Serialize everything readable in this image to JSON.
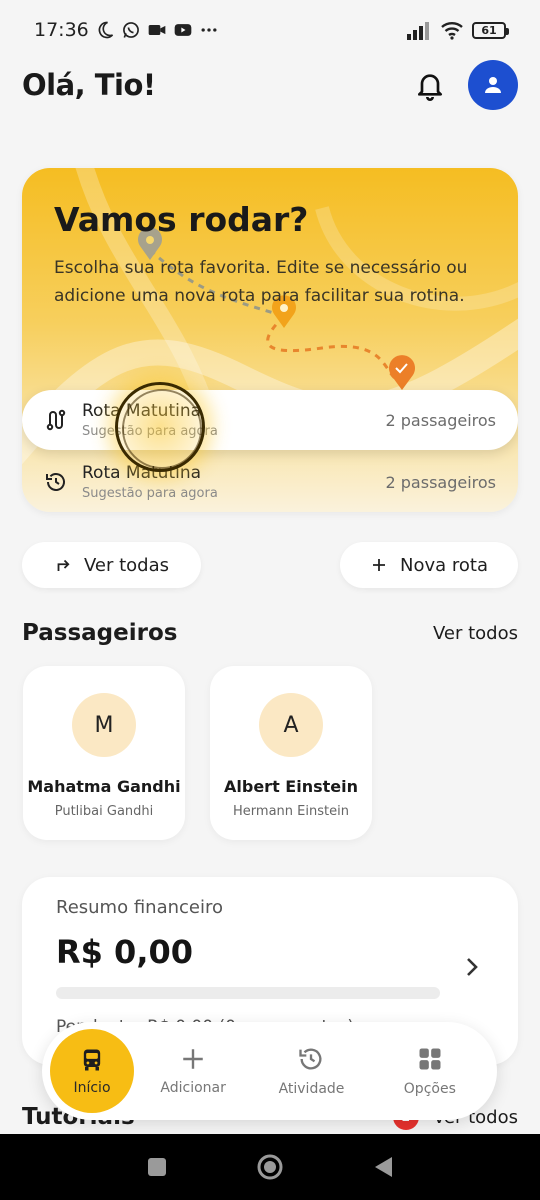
{
  "status_bar": {
    "time": "17:36",
    "battery": "61"
  },
  "header": {
    "greeting": "Olá, Tio!"
  },
  "hero": {
    "title": "Vamos rodar?",
    "description": "Escolha sua rota favorita. Edite se necessário ou adicione uma nova rota para facilitar sua rotina.",
    "routes": [
      {
        "name": "Rota Matutina",
        "subtitle": "Sugestão para agora",
        "count": "2 passageiros"
      },
      {
        "name": "Rota Matutina",
        "subtitle": "Sugestão para agora",
        "count": "2 passageiros"
      }
    ]
  },
  "actions": {
    "view_all": "Ver todas",
    "new_route": "Nova rota"
  },
  "passengers": {
    "title": "Passageiros",
    "link": "Ver todos",
    "items": [
      {
        "initial": "M",
        "name": "Mahatma Gandhi",
        "guardian": "Putlibai Gandhi"
      },
      {
        "initial": "A",
        "name": "Albert Einstein",
        "guardian": "Hermann Einstein"
      }
    ]
  },
  "finance": {
    "title": "Resumo financeiro",
    "value": "R$ 0,00",
    "footer": "Pendente: R$ 0,00 (0 pagamentos)"
  },
  "tutorials": {
    "title": "Tutoriais",
    "badge": "2",
    "link": "Ver todos"
  },
  "bottom_nav": [
    {
      "label": "Início",
      "icon": "bus-icon"
    },
    {
      "label": "Adicionar",
      "icon": "plus-icon"
    },
    {
      "label": "Atividade",
      "icon": "history-icon"
    },
    {
      "label": "Opções",
      "icon": "grid-icon"
    }
  ],
  "colors": {
    "accent": "#f7bd14",
    "primary_blue": "#1d4fd0",
    "badge_red": "#e8322e"
  }
}
